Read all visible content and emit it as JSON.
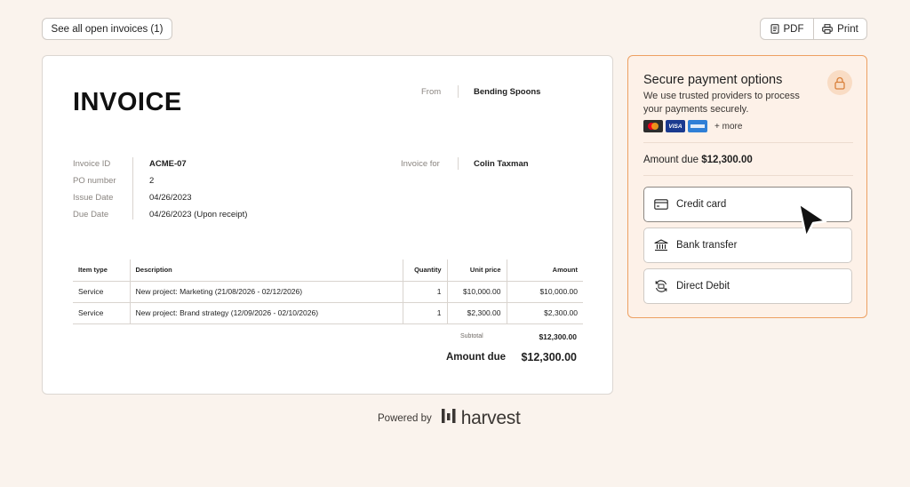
{
  "toolbar": {
    "see_all_label": "See all open invoices (1)",
    "pdf_label": "PDF",
    "print_label": "Print"
  },
  "invoice": {
    "title": "INVOICE",
    "from_label": "From",
    "from_value": "Bending Spoons",
    "for_label": "Invoice for",
    "for_value": "Colin Taxman",
    "meta": [
      {
        "label": "Invoice ID",
        "value": "ACME-07"
      },
      {
        "label": "PO number",
        "value": "2"
      },
      {
        "label": "Issue Date",
        "value": "04/26/2023"
      },
      {
        "label": "Due Date",
        "value": "04/26/2023 (Upon receipt)"
      }
    ],
    "columns": [
      "Item type",
      "Description",
      "Quantity",
      "Unit price",
      "Amount"
    ],
    "rows": [
      [
        "Service",
        "New project: Marketing (21/08/2026 - 02/12/2026)",
        "1",
        "$10,000.00",
        "$10,000.00"
      ],
      [
        "Service",
        "New project: Brand strategy (12/09/2026 - 02/10/2026)",
        "1",
        "$2,300.00",
        "$2,300.00"
      ]
    ],
    "subtotal_label": "Subtotal",
    "subtotal_value": "$12,300.00",
    "amount_due_label": "Amount due",
    "amount_due_value": "$12,300.00"
  },
  "payment": {
    "title": "Secure payment options",
    "subtitle": "We use trusted providers to process your payments securely.",
    "visa_text": "VISA",
    "more_text": "+ more",
    "amount_due_prefix": "Amount due",
    "amount_due_value": "$12,300.00",
    "options": [
      {
        "label": "Credit card",
        "icon": "credit-card-icon"
      },
      {
        "label": "Bank transfer",
        "icon": "bank-icon"
      },
      {
        "label": "Direct Debit",
        "icon": "direct-debit-icon"
      }
    ]
  },
  "footer": {
    "powered_by": "Powered by",
    "brand": "harvest"
  },
  "colors": {
    "background": "#faf3ed",
    "accent": "#eda062",
    "panel": "#fdf1e8"
  }
}
